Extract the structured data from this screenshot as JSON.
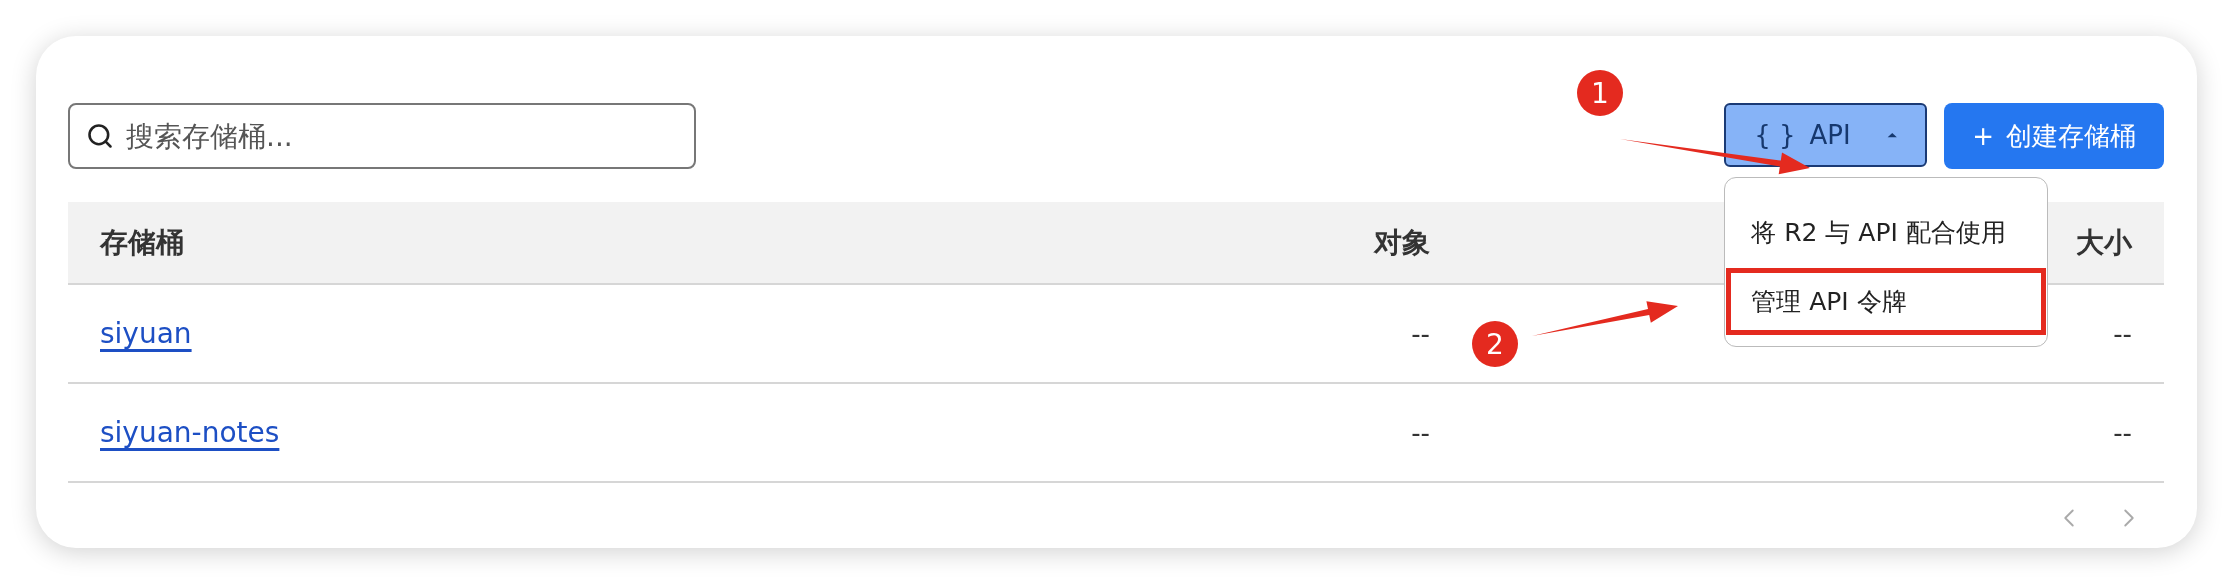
{
  "search": {
    "placeholder": "搜索存储桶..."
  },
  "api_button": {
    "icon": "{ }",
    "label": "API",
    "expanded": true
  },
  "create_button": {
    "icon": "+",
    "label": "创建存储桶"
  },
  "api_menu": [
    {
      "label": "将 R2 与 API 配合使用",
      "highlighted": false
    },
    {
      "label": "管理 API 令牌",
      "highlighted": true
    }
  ],
  "table": {
    "columns": [
      "存储桶",
      "对象",
      "大小"
    ],
    "rows": [
      {
        "name": "siyuan",
        "objects": "--",
        "size": "--"
      },
      {
        "name": "siyuan-notes",
        "objects": "--",
        "size": "--"
      }
    ]
  },
  "annotations": [
    {
      "label": "1"
    },
    {
      "label": "2"
    }
  ]
}
